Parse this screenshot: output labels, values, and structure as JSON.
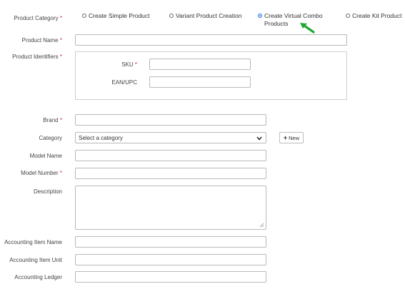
{
  "product_category": {
    "label": "Product Category",
    "options": [
      {
        "label": "Create Simple Product",
        "checked": false
      },
      {
        "label": "Variant Product Creation",
        "checked": false
      },
      {
        "label": "Create Virtual Combo",
        "label2": "Products",
        "checked": true
      },
      {
        "label": "Create Kit Product",
        "checked": false
      }
    ]
  },
  "fields": {
    "product_name": {
      "label": "Product Name",
      "value": ""
    },
    "product_identifiers": {
      "label": "Product Identifiers"
    },
    "sku": {
      "label": "SKU",
      "value": ""
    },
    "ean_upc": {
      "label": "EAN/UPC",
      "value": ""
    },
    "brand": {
      "label": "Brand",
      "value": ""
    },
    "category": {
      "label": "Category",
      "selected": "Select a category"
    },
    "new_button": {
      "label": "New"
    },
    "model_name": {
      "label": "Model Name",
      "value": ""
    },
    "model_number": {
      "label": "Model Number",
      "value": ""
    },
    "description": {
      "label": "Description",
      "value": ""
    },
    "accounting_item_name": {
      "label": "Accounting Item Name",
      "value": ""
    },
    "accounting_item_unit": {
      "label": "Accounting Item Unit",
      "value": ""
    },
    "accounting_ledger": {
      "label": "Accounting Ledger",
      "value": ""
    }
  },
  "required_marker": "*",
  "colors": {
    "required": "#e0282e",
    "radio_selected": "#1a73e8",
    "annotation_arrow": "#22a833"
  },
  "icons": {
    "dropdown": "chevron-down-icon",
    "add": "plus-icon",
    "resize": "resize-grip-icon",
    "annotation": "green-arrow-icon"
  }
}
